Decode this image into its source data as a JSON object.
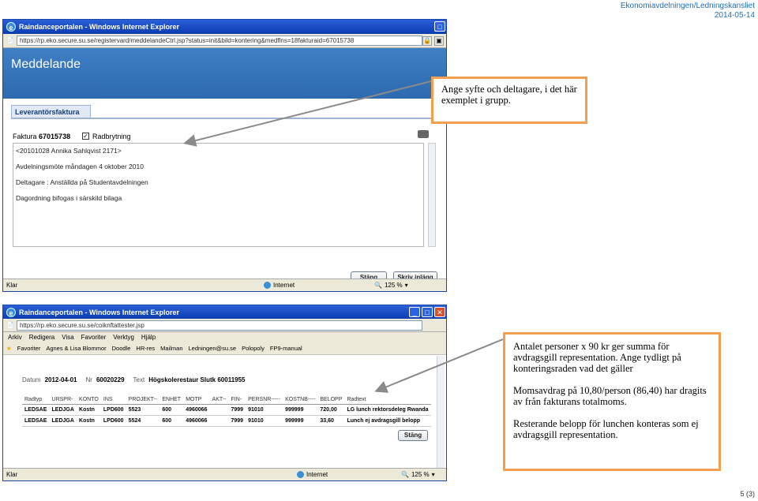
{
  "header": {
    "line1": "Ekonomiavdelningen/Ledningskansliet",
    "line2": "2014-05-14"
  },
  "footer": {
    "page": "5 (3)"
  },
  "window1": {
    "title": "Raindanceportalen - Windows Internet Explorer",
    "address": "https://rp.eko.secure.su.se/registervard/meddelandeCtrl.jsp?status=init&bild=kontering&medflns=18fakturaid=67015738",
    "heading": "Meddelande",
    "tab": "Leverantörsfaktura",
    "faktura_label": "Faktura",
    "faktura_number": "67015738",
    "radbrytning": "Radbrytning",
    "lines": [
      "<20101028 Annika Sahlqvist 2171>",
      "Avdelningsmöte måndagen 4 oktober 2010",
      "Deltagare : Anställda på Studentavdelningen",
      "Dagordning bifogas i särskild bilaga"
    ],
    "btn_close": "Stäng",
    "btn_print": "Skriv inlägg",
    "status_left": "Klar",
    "status_zone": "Internet",
    "status_zoom": "125 %"
  },
  "window2": {
    "title": "Raindanceportalen - Windows Internet Explorer",
    "address": "https://rp.eko.secure.su.se/coiknftattester.jsp",
    "menu": [
      "Arkiv",
      "Redigera",
      "Visa",
      "Favoriter",
      "Verktyg",
      "Hjälp"
    ],
    "favorites": [
      "Favoriter",
      "Agnes & Lisa Blommor",
      "Doodle",
      "HR-res",
      "Mailman",
      "Ledningen@su.se",
      "Polopoly",
      "FP9-manual"
    ],
    "datum_label": "Datum",
    "datum_value": "2012-04-01",
    "nr_label": "Nr",
    "nr_value": "60020229",
    "text_label": "Text",
    "text_value": "Högskolerestaur Slutk 60011955",
    "columns": [
      "Radtyp",
      "URSPR-",
      "KONTO",
      "INS",
      "PROJEKT--",
      "ENHET",
      "MOTP",
      "AKT--",
      "FIN-",
      "PERSNR-----",
      "KOSTNB----",
      "BELOPP",
      "Radtext"
    ],
    "rows": [
      [
        "LEDSAE",
        "LEDJGA",
        "Kostn",
        "LPD600",
        "5523",
        "600",
        "4960066",
        "",
        "7999",
        "91010",
        "999999",
        "720,00",
        "LG lunch rektorsdeleg Rwanda"
      ],
      [
        "LEDSAE",
        "LEDJGA",
        "Kostn",
        "LPD600",
        "5524",
        "600",
        "4960066",
        "",
        "7999",
        "91010",
        "999999",
        "33,60",
        "Lunch ej avdragsgill belopp"
      ]
    ],
    "btn_close": "Stäng",
    "status_left": "Klar",
    "status_zone": "Internet",
    "status_zoom": "125 %"
  },
  "callout1": {
    "text": "Ange syfte och deltagare, i det här exemplet i grupp."
  },
  "callout2": {
    "p1": "Antalet personer x 90 kr ger summa för avdragsgill representation. Ange tydligt på konteringsraden vad det gäller",
    "p2": "Momsavdrag på 10,80/person (86,40) har dragits av från fakturans totalmoms.",
    "p3": "Resterande belopp för lunchen konteras som ej avdragsgill representation."
  },
  "colors": {
    "callout_border": "#f0a050",
    "titlebar": "#0c3cb0",
    "heading_bar": "#2d6ab0"
  }
}
